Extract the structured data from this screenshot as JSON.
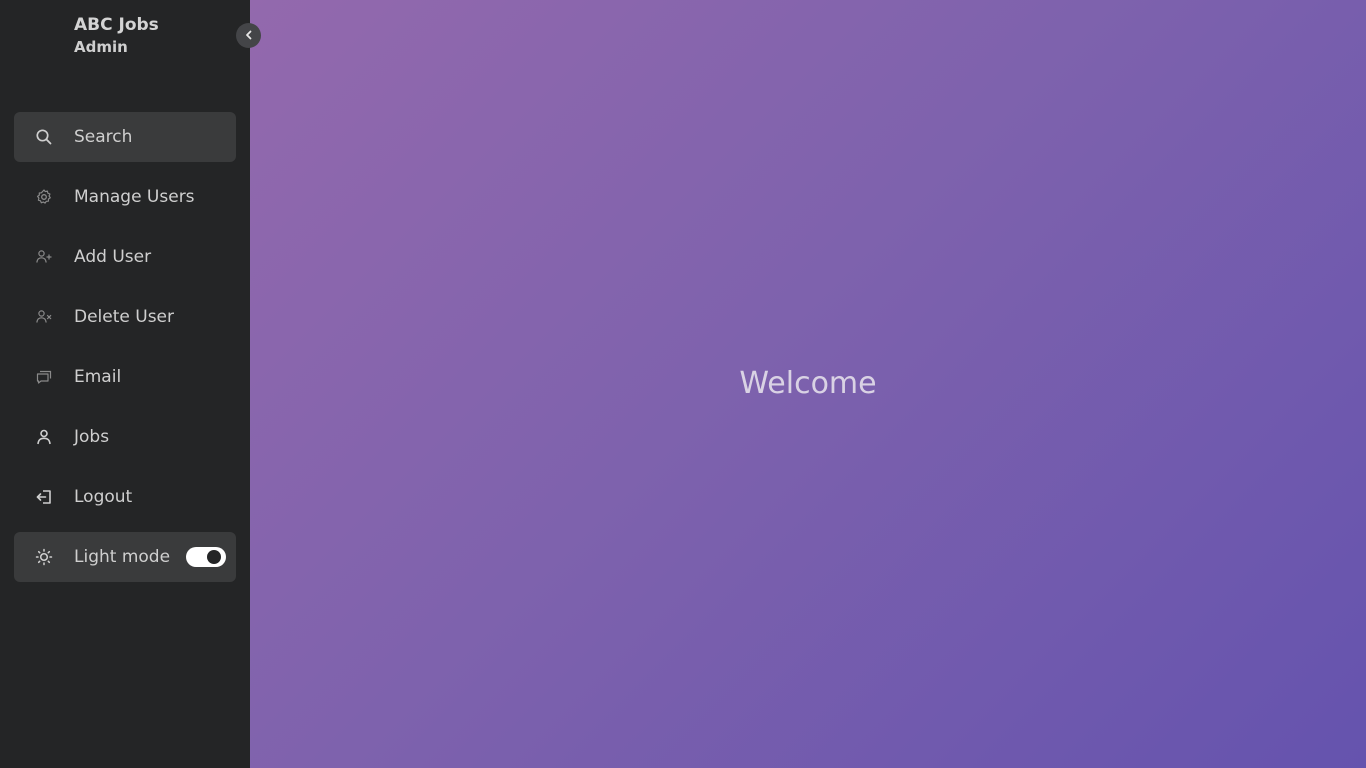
{
  "sidebar": {
    "brand": {
      "title": "ABC Jobs",
      "subtitle": "Admin"
    },
    "collapse_icon": "chevron-left-icon",
    "items": [
      {
        "label": "Search",
        "icon": "search-icon",
        "active": true
      },
      {
        "label": "Manage Users",
        "icon": "gear-icon"
      },
      {
        "label": "Add User",
        "icon": "user-plus-icon"
      },
      {
        "label": "Delete User",
        "icon": "user-x-icon"
      },
      {
        "label": "Email",
        "icon": "chat-icon"
      },
      {
        "label": "Jobs",
        "icon": "user-icon"
      },
      {
        "label": "Logout",
        "icon": "logout-icon"
      }
    ],
    "mode": {
      "label": "Light mode",
      "icon": "sun-icon",
      "toggle_on": true
    }
  },
  "main": {
    "welcome": "Welcome"
  },
  "colors": {
    "sidebar_bg": "#242526",
    "active_item_bg": "#3a3b3c",
    "gradient_start": "#9369ad",
    "gradient_end": "#6553ae",
    "text": "#cfcfcf"
  }
}
